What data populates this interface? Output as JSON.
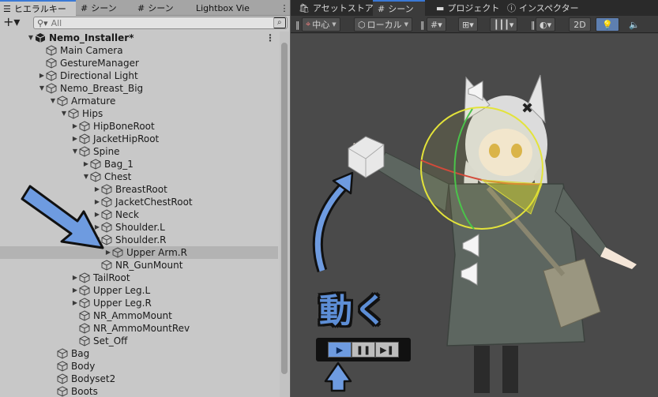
{
  "hierarchy": {
    "tabs": [
      {
        "icon": "hierarchy-icon",
        "label": "ヒエラルキー",
        "active": true
      },
      {
        "icon": "scene-grid-icon",
        "label": "シーン",
        "active": false
      },
      {
        "icon": "scene-grid-icon",
        "label": "シーン",
        "active": false
      },
      {
        "icon": "",
        "label": "Lightbox Vie",
        "active": false
      }
    ],
    "more_label": "⋮",
    "add_label": "+▾",
    "search_placeholder": "All",
    "search_button": "⌕",
    "scene_menu": "⋮",
    "tree": [
      {
        "depth": 0,
        "arrow": "down",
        "label": "Nemo_Installer*",
        "scene": true,
        "selected": false
      },
      {
        "depth": 1,
        "arrow": "",
        "label": "Main Camera",
        "selected": false
      },
      {
        "depth": 1,
        "arrow": "",
        "label": "GestureManager",
        "selected": false
      },
      {
        "depth": 1,
        "arrow": "right",
        "label": "Directional Light",
        "selected": false
      },
      {
        "depth": 1,
        "arrow": "down",
        "label": "Nemo_Breast_Big",
        "selected": false
      },
      {
        "depth": 2,
        "arrow": "down",
        "label": "Armature",
        "selected": false
      },
      {
        "depth": 3,
        "arrow": "down",
        "label": "Hips",
        "selected": false
      },
      {
        "depth": 4,
        "arrow": "right",
        "label": "HipBoneRoot",
        "selected": false
      },
      {
        "depth": 4,
        "arrow": "right",
        "label": "JacketHipRoot",
        "selected": false
      },
      {
        "depth": 4,
        "arrow": "down",
        "label": "Spine",
        "selected": false
      },
      {
        "depth": 5,
        "arrow": "right",
        "label": "Bag_1",
        "selected": false
      },
      {
        "depth": 5,
        "arrow": "down",
        "label": "Chest",
        "selected": false
      },
      {
        "depth": 6,
        "arrow": "right",
        "label": "BreastRoot",
        "selected": false
      },
      {
        "depth": 6,
        "arrow": "right",
        "label": "JacketChestRoot",
        "selected": false
      },
      {
        "depth": 6,
        "arrow": "right",
        "label": "Neck",
        "selected": false
      },
      {
        "depth": 6,
        "arrow": "right",
        "label": "Shoulder.L",
        "selected": false
      },
      {
        "depth": 6,
        "arrow": "down",
        "label": "Shoulder.R",
        "selected": false
      },
      {
        "depth": 7,
        "arrow": "right",
        "label": "Upper Arm.R",
        "selected": true
      },
      {
        "depth": 6,
        "arrow": "",
        "label": "NR_GunMount",
        "selected": false
      },
      {
        "depth": 4,
        "arrow": "right",
        "label": "TailRoot",
        "selected": false
      },
      {
        "depth": 4,
        "arrow": "right",
        "label": "Upper Leg.L",
        "selected": false
      },
      {
        "depth": 4,
        "arrow": "right",
        "label": "Upper Leg.R",
        "selected": false
      },
      {
        "depth": 4,
        "arrow": "",
        "label": "NR_AmmoMount",
        "selected": false
      },
      {
        "depth": 4,
        "arrow": "",
        "label": "NR_AmmoMountRev",
        "selected": false
      },
      {
        "depth": 4,
        "arrow": "",
        "label": "Set_Off",
        "selected": false
      },
      {
        "depth": 2,
        "arrow": "",
        "label": "Bag",
        "selected": false
      },
      {
        "depth": 2,
        "arrow": "",
        "label": "Body",
        "selected": false
      },
      {
        "depth": 2,
        "arrow": "",
        "label": "Bodyset2",
        "selected": false
      },
      {
        "depth": 2,
        "arrow": "",
        "label": "Boots",
        "selected": false
      }
    ]
  },
  "scene": {
    "tabs": [
      {
        "icon": "asset-store-icon",
        "label": "アセットストア",
        "active": false
      },
      {
        "icon": "scene-grid-icon",
        "label": "シーン",
        "active": true
      },
      {
        "icon": "project-folder-icon",
        "label": "プロジェクト",
        "active": false
      },
      {
        "icon": "inspector-info-icon",
        "label": "インスペクター",
        "active": false
      }
    ],
    "toolbar": {
      "pivot_mode": "中心",
      "pivot_rotation": "ローカル",
      "view_2d": "2D"
    },
    "annotation_text": "動く",
    "playback": {
      "play_icon": "▶",
      "pause_icon": "❚❚",
      "step_icon": "▶❚"
    },
    "colors": {
      "accent": "#5d8ed6",
      "selection": "#b3b3b3",
      "viewport_bg": "#4a4a4a"
    }
  }
}
